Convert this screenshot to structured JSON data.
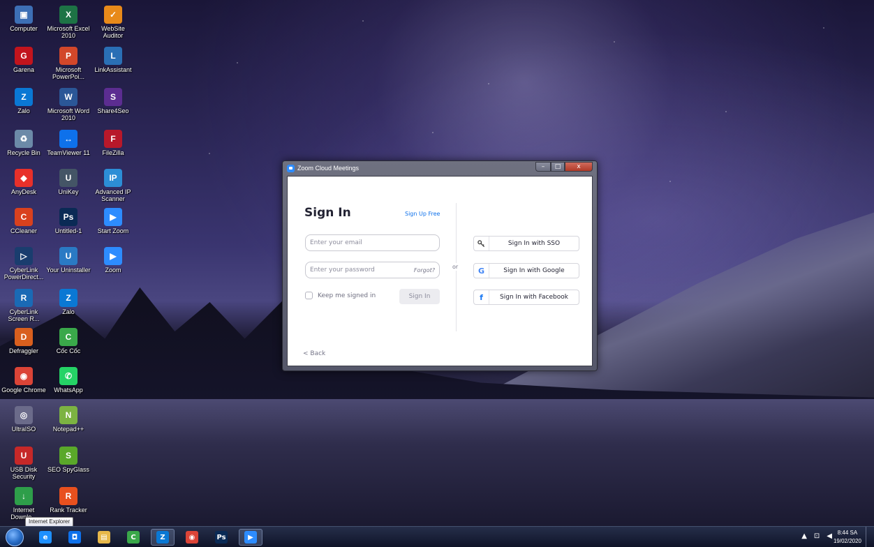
{
  "desktop": {
    "icons": [
      {
        "label": "Computer",
        "color": "#3d6fb5",
        "glyph": "▣"
      },
      {
        "label": "Microsoft Excel 2010",
        "color": "#1d7345",
        "glyph": "X"
      },
      {
        "label": "WebSite Auditor",
        "color": "#e88a1a",
        "glyph": "✓"
      },
      {
        "label": "Garena",
        "color": "#c2141d",
        "glyph": "G"
      },
      {
        "label": "Microsoft PowerPoi...",
        "color": "#d2472a",
        "glyph": "P"
      },
      {
        "label": "LinkAssistant",
        "color": "#2a6fb5",
        "glyph": "L"
      },
      {
        "label": "Zalo",
        "color": "#0a78d4",
        "glyph": "Z"
      },
      {
        "label": "Microsoft Word 2010",
        "color": "#2b5797",
        "glyph": "W"
      },
      {
        "label": "Share4Seo",
        "color": "#5c2d91",
        "glyph": "S"
      },
      {
        "label": "Recycle Bin",
        "color": "#6c8aa8",
        "glyph": "♻"
      },
      {
        "label": "TeamViewer 11",
        "color": "#0e71eb",
        "glyph": "↔"
      },
      {
        "label": "FileZilla",
        "color": "#b8182a",
        "glyph": "F"
      },
      {
        "label": "AnyDesk",
        "color": "#e8302a",
        "glyph": "◆"
      },
      {
        "label": "UniKey",
        "color": "#445566",
        "glyph": "U"
      },
      {
        "label": "Advanced IP Scanner",
        "color": "#2c8ed6",
        "glyph": "IP"
      },
      {
        "label": "CCleaner",
        "color": "#d9411e",
        "glyph": "C"
      },
      {
        "label": "Untitled-1",
        "color": "#0a2a55",
        "glyph": "Ps"
      },
      {
        "label": "Start Zoom",
        "color": "#2d8cff",
        "glyph": "▶"
      },
      {
        "label": "CyberLink PowerDirect...",
        "color": "#1a3d6e",
        "glyph": "▷"
      },
      {
        "label": "Your Uninstaller",
        "color": "#2a7ac4",
        "glyph": "U"
      },
      {
        "label": "Zoom",
        "color": "#2d8cff",
        "glyph": "▶"
      },
      {
        "label": "CyberLink Screen R...",
        "color": "#1a6ab5",
        "glyph": "R"
      },
      {
        "label": "Zalo",
        "color": "#0a78d4",
        "glyph": "Z"
      },
      {
        "label": "Defraggler",
        "color": "#d95f1e",
        "glyph": "D"
      },
      {
        "label": "Cốc Cốc",
        "color": "#3aa84a",
        "glyph": "C"
      },
      {
        "label": "Google Chrome",
        "color": "#db4437",
        "glyph": "◉"
      },
      {
        "label": "WhatsApp",
        "color": "#25d366",
        "glyph": "✆"
      },
      {
        "label": "UltraISO",
        "color": "#6b6b8a",
        "glyph": "◎"
      },
      {
        "label": "Notepad++",
        "color": "#7cb342",
        "glyph": "N"
      },
      {
        "label": "USB Disk Security",
        "color": "#c62828",
        "glyph": "U"
      },
      {
        "label": "SEO SpyGlass",
        "color": "#5aa82a",
        "glyph": "S"
      },
      {
        "label": "Internet Downlo...",
        "color": "#2e9e4a",
        "glyph": "↓"
      },
      {
        "label": "Rank Tracker",
        "color": "#e8501e",
        "glyph": "R"
      }
    ]
  },
  "tooltip": "Internet Explorer",
  "window": {
    "title": "Zoom Cloud Meetings",
    "minimize": "–",
    "maximize": "□",
    "close": "x",
    "signin_title": "Sign In",
    "signup_link": "Sign Up Free",
    "email_placeholder": "Enter your email",
    "password_placeholder": "Enter your password",
    "forgot": "Forgot?",
    "keep_signed_in": "Keep me signed in",
    "signin_button": "Sign In",
    "or": "or",
    "sso_label": "Sign In with SSO",
    "google_label": "Sign In with Google",
    "facebook_label": "Sign In with Facebook",
    "back": "< Back",
    "colors": {
      "link": "#0e71eb",
      "google": "#4285f4",
      "facebook": "#1877f2"
    }
  },
  "taskbar": {
    "apps": [
      {
        "name": "internet-explorer",
        "glyph": "e",
        "color": "#1e90ff"
      },
      {
        "name": "teamviewer",
        "glyph": "◘",
        "color": "#0e71eb"
      },
      {
        "name": "windows-explorer",
        "glyph": "▤",
        "color": "#e7b84a"
      },
      {
        "name": "coc-coc",
        "glyph": "C",
        "color": "#3aa84a"
      },
      {
        "name": "zalo",
        "glyph": "Z",
        "color": "#0a78d4"
      },
      {
        "name": "google-chrome",
        "glyph": "◉",
        "color": "#db4437"
      },
      {
        "name": "photoshop",
        "glyph": "Ps",
        "color": "#0a2a55"
      },
      {
        "name": "zoom",
        "glyph": "▶",
        "color": "#2d8cff"
      }
    ],
    "tray_up": "▲",
    "tray_network": "⊡",
    "tray_volume": "◀",
    "time": "8:44 SA",
    "date": "19/02/2020"
  }
}
